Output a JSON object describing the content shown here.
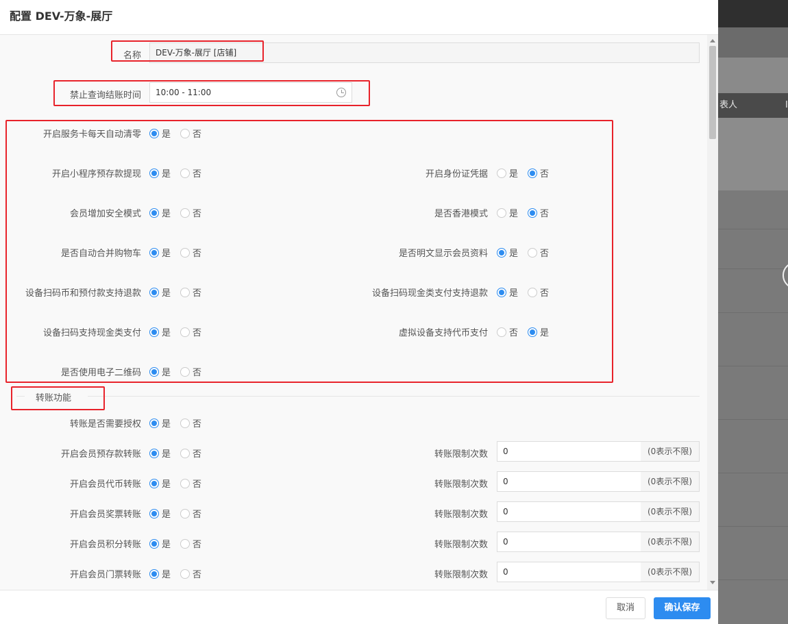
{
  "modal": {
    "title": "配置 DEV-万象-展厅",
    "name_label": "名称",
    "name_value": "DEV-万象-展厅 [店铺]",
    "time_label": "禁止查询结账时间",
    "time_value": "10:00 - 11:00",
    "yes": "是",
    "no": "否",
    "settings": [
      {
        "label": "开启服务卡每天自动清零",
        "selected": "是"
      },
      {
        "label": "开启小程序预存款提现",
        "selected": "是"
      },
      {
        "label": "开启身份证凭据",
        "selected": "否"
      },
      {
        "label": "会员增加安全模式",
        "selected": "是"
      },
      {
        "label": "是否香港模式",
        "selected": "否"
      },
      {
        "label": "是否自动合并购物车",
        "selected": "是"
      },
      {
        "label": "是否明文显示会员资料",
        "selected": "是"
      },
      {
        "label": "设备扫码币和预付款支持退款",
        "selected": "是"
      },
      {
        "label": "设备扫码现金类支付支持退款",
        "selected": "是"
      },
      {
        "label": "设备扫码支持现金类支付",
        "selected": "是"
      },
      {
        "label": "虚拟设备支持代币支付",
        "selected": "是"
      },
      {
        "label": "是否使用电子二维码",
        "selected": "是"
      }
    ],
    "transfer_section_title": "转账功能",
    "transfer_auth_label": "转账是否需要授权",
    "transfer_auth_selected": "是",
    "transfer_limit_label": "转账限制次数",
    "transfer_limit_addon": "(0表示不限)",
    "transfers": [
      {
        "label": "开启会员预存款转账",
        "selected": "是",
        "limit": "0"
      },
      {
        "label": "开启会员代币转账",
        "selected": "是",
        "limit": "0"
      },
      {
        "label": "开启会员奖票转账",
        "selected": "是",
        "limit": "0"
      },
      {
        "label": "开启会员积分转账",
        "selected": "是",
        "limit": "0"
      },
      {
        "label": "开启会员门票转账",
        "selected": "是",
        "limit": "0"
      }
    ],
    "cancel_label": "取消",
    "save_label": "确认保存"
  },
  "background": {
    "header_col1": "表人",
    "header_col2": "I"
  },
  "colors": {
    "accent": "#2d8cf0",
    "highlight_box": "#e8222a"
  }
}
